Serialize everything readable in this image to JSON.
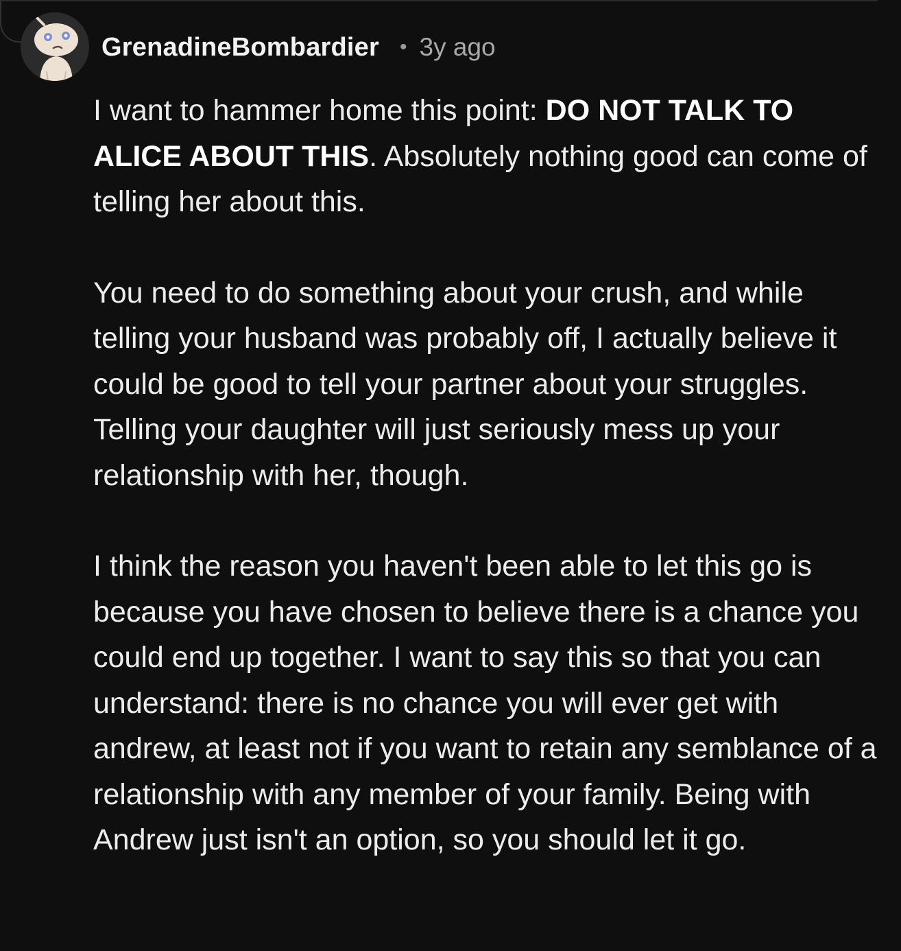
{
  "comment": {
    "author": "GrenadineBombardier",
    "separator": "•",
    "timestamp": "3y ago",
    "avatar_icon": "reddit-snoo-avatar-icon",
    "paragraphs": [
      {
        "before": "I want to hammer home this point: ",
        "bold": "DO NOT TALK TO ALICE ABOUT THIS",
        "after": ". Absolutely nothing good can come of telling her about this."
      },
      {
        "text": "You need to do something about your crush, and while telling your husband was probably off, I actually believe it could be good to tell your partner about your struggles. Telling your daughter will just seriously mess up your relationship with her, though."
      },
      {
        "text": "I think the reason you haven't been able to let this go is because you have chosen to believe there is a chance you could end up together. I want to say this so that you can understand: there is no chance you will ever get with andrew, at least not if you want to retain any semblance of a relationship with any member of your family. Being with Andrew just isn't an option, so you should let it go."
      }
    ]
  },
  "colors": {
    "background": "#0f0f0f",
    "text": "#ececec",
    "meta": "#a8a8a8",
    "avatar_bg": "#2b2b2b",
    "avatar_eye": "#7d8fd6"
  }
}
